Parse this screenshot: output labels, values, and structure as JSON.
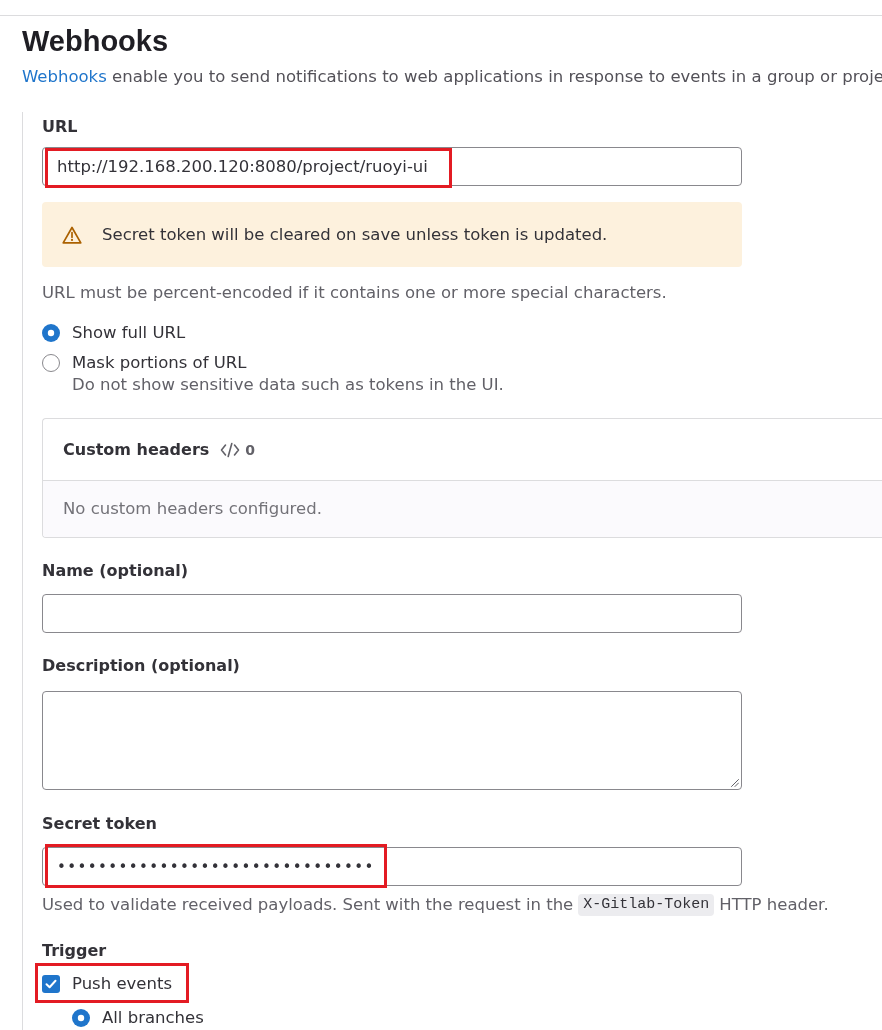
{
  "page": {
    "title": "Webhooks",
    "description": {
      "link": "Webhooks",
      "text": "enable you to send notifications to web applications in response to events in a group or proje"
    }
  },
  "url": {
    "label": "URL",
    "value": "http://192.168.200.120:8080/project/ruoyi-ui",
    "highlighted": true
  },
  "alert": {
    "kind": "warning",
    "text": "Secret token will be cleared on save unless token is updated."
  },
  "url_help": "URL must be percent-encoded if it contains one or more special characters.",
  "url_display": [
    {
      "label": "Show full URL",
      "selected": true
    },
    {
      "label": "Mask portions of URL",
      "selected": false,
      "help": "Do not show sensitive data such as tokens in the UI."
    }
  ],
  "custom_headers": {
    "title": "Custom headers",
    "count": "0",
    "empty_text": "No custom headers configured."
  },
  "fields": [
    {
      "kind": "input",
      "label": "Name (optional)"
    },
    {
      "kind": "textarea",
      "label": "Description (optional)"
    },
    {
      "kind": "secret",
      "label": "Secret token",
      "value": "•••••••••••••••••••••••••••••••",
      "highlighted": true,
      "help": {
        "text_before": "Used to validate received payloads. Sent with the request in the",
        "code": "X-Gitlab-Token",
        "text_after": "HTTP header."
      }
    }
  ],
  "trigger": {
    "title": "Trigger",
    "events": [
      {
        "label": "Push events",
        "checked": true,
        "highlighted": true,
        "branch_options": [
          {
            "label": "All branches",
            "selected": true
          }
        ]
      }
    ]
  }
}
